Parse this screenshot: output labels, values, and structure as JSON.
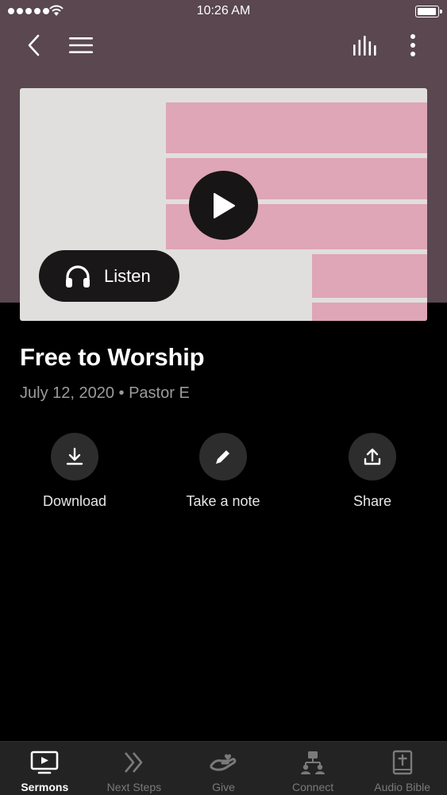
{
  "status_bar": {
    "time": "10:26 AM"
  },
  "sermon": {
    "title": "Free to Worship",
    "meta": "July 12, 2020 • Pastor E",
    "listen_label": "Listen"
  },
  "actions": [
    {
      "label": "Download",
      "icon": "download-icon"
    },
    {
      "label": "Take a note",
      "icon": "pencil-icon"
    },
    {
      "label": "Share",
      "icon": "share-icon"
    }
  ],
  "tabs": [
    {
      "label": "Sermons",
      "icon": "tv-play-icon",
      "active": true
    },
    {
      "label": "Next Steps",
      "icon": "double-chevron-icon",
      "active": false
    },
    {
      "label": "Give",
      "icon": "hand-heart-icon",
      "active": false
    },
    {
      "label": "Connect",
      "icon": "people-network-icon",
      "active": false
    },
    {
      "label": "Audio Bible",
      "icon": "bible-icon",
      "active": false
    }
  ],
  "colors": {
    "hero_background": "#5a474f",
    "card_pink": "#dea6b6",
    "tab_bar": "#232323"
  }
}
